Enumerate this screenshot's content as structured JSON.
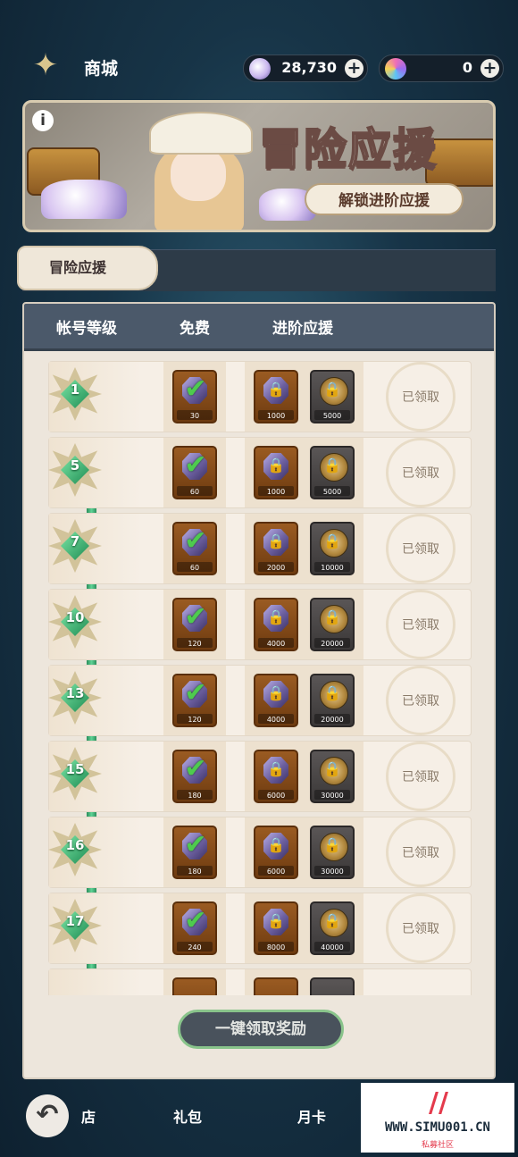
{
  "header": {
    "title": "商城",
    "gems": "28,730",
    "coins": "0",
    "plus": "+"
  },
  "banner": {
    "info_symbol": "i",
    "title": "冒险应援",
    "unlock_button": "解锁进阶应援"
  },
  "tab": {
    "label": "冒险应援"
  },
  "table": {
    "columns": [
      "帐号等级",
      "免费",
      "进阶应援"
    ],
    "claimed_label": "已领取",
    "rows": [
      {
        "level": "1",
        "free": "30",
        "adv_gem": "1000",
        "adv_coin": "5000"
      },
      {
        "level": "5",
        "free": "60",
        "adv_gem": "1000",
        "adv_coin": "5000"
      },
      {
        "level": "7",
        "free": "60",
        "adv_gem": "2000",
        "adv_coin": "10000"
      },
      {
        "level": "10",
        "free": "120",
        "adv_gem": "4000",
        "adv_coin": "20000"
      },
      {
        "level": "13",
        "free": "120",
        "adv_gem": "4000",
        "adv_coin": "20000"
      },
      {
        "level": "15",
        "free": "180",
        "adv_gem": "6000",
        "adv_coin": "30000"
      },
      {
        "level": "16",
        "free": "180",
        "adv_gem": "6000",
        "adv_coin": "30000"
      },
      {
        "level": "17",
        "free": "240",
        "adv_gem": "8000",
        "adv_coin": "40000"
      }
    ]
  },
  "claim_all_button": "一键领取奖励",
  "bottom_nav": {
    "back_symbol": "↶",
    "store": "店",
    "gift": "礼包",
    "monthly": "月卡"
  },
  "watermark": {
    "mark": "//",
    "url": "WWW.SIMU001.CN",
    "sub": "私募社区"
  },
  "colors": {
    "accent_green": "#4ecb4e",
    "track_green": "#5ed396",
    "panel_bg": "#ede6dc",
    "header_bg": "#4b596a"
  }
}
